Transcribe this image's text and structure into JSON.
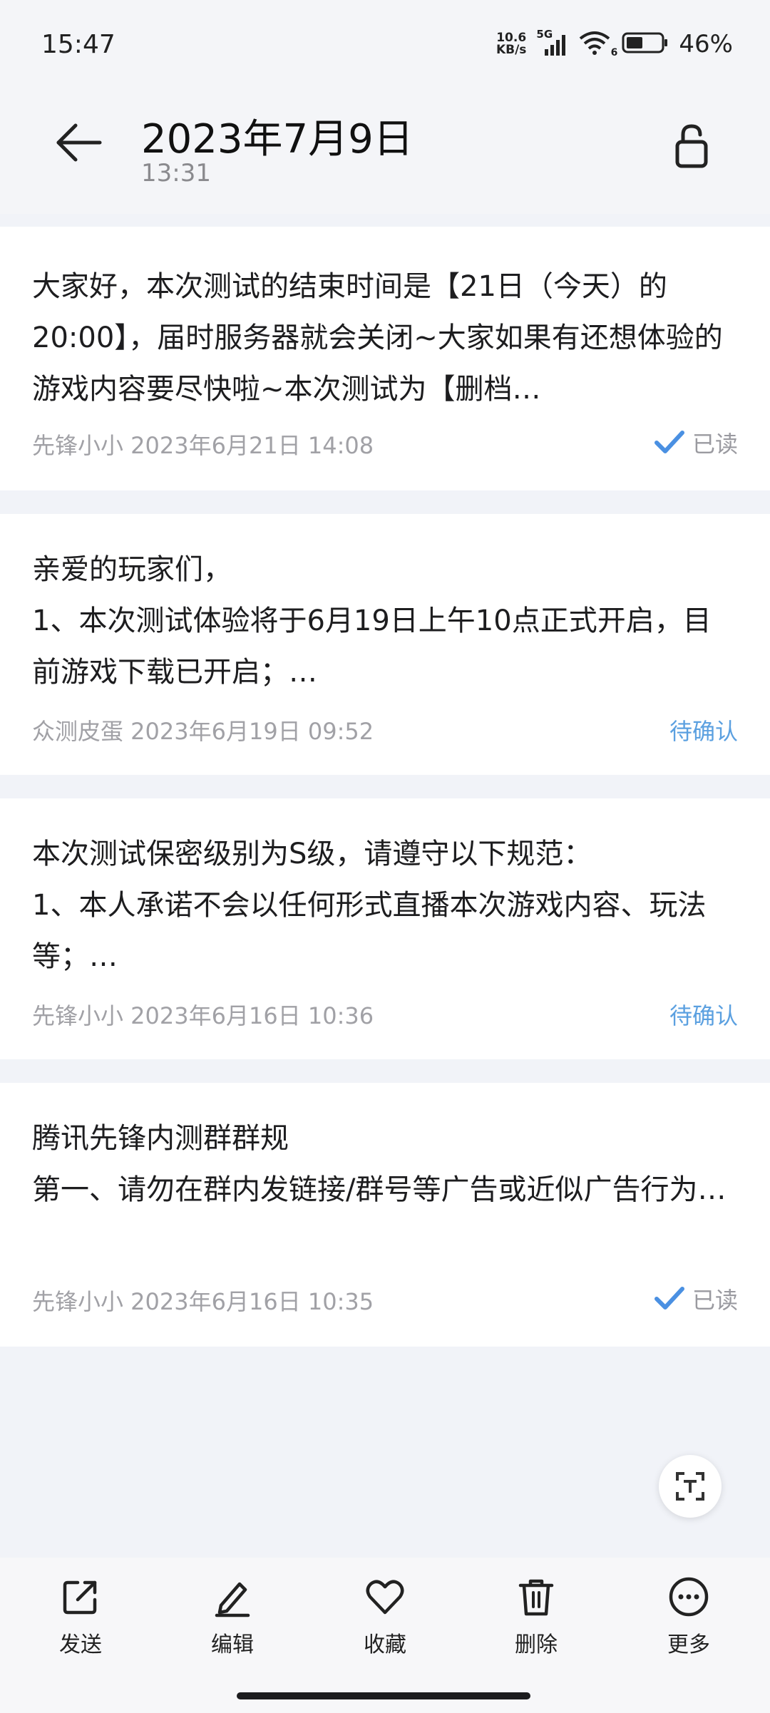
{
  "status_bar": {
    "time": "15:47",
    "net_speed_value": "10.6",
    "net_speed_unit": "KB/s",
    "network": "5G",
    "wifi_badge": "6",
    "battery": "46%"
  },
  "header": {
    "title": "2023年7月9日",
    "subtitle": "13:31"
  },
  "messages": [
    {
      "text": "大家好，本次测试的结束时间是【21日（今天）的20:00】，届时服务器就会关闭~大家如果有还想体验的游戏内容要尽快啦~本次测试为【删档…",
      "sender_date": "先锋小小 2023年6月21日 14:08",
      "status": "已读"
    },
    {
      "text_lines": [
        "亲爱的玩家们，",
        "1、本次测试体验将于6月19日上午10点正式开启，目前游戏下载已开启；…"
      ],
      "sender_date": "众测皮蛋 2023年6月19日 09:52",
      "status": "待确认"
    },
    {
      "text_lines": [
        "本次测试保密级别为S级，请遵守以下规范：",
        "1、本人承诺不会以任何形式直播本次游戏内容、玩法等；…"
      ],
      "sender_date": "先锋小小 2023年6月16日 10:36",
      "status": "待确认"
    },
    {
      "text_lines": [
        "腾讯先锋内测群群规",
        "第一、请勿在群内发链接/群号等广告或近似广告行为…"
      ],
      "sender_date": "先锋小小 2023年6月16日 10:35",
      "status": "已读"
    }
  ],
  "toolbar": {
    "send": "发送",
    "edit": "编辑",
    "favorite": "收藏",
    "delete": "删除",
    "more": "更多"
  },
  "icons": {
    "back": "arrow-left-icon",
    "lock": "unlock-icon",
    "scan": "text-scan-icon",
    "read_check": "check-icon"
  },
  "colors": {
    "read_check": "#4a90e2",
    "pending": "#5ba0e0",
    "meta": "#a1a1a6"
  }
}
